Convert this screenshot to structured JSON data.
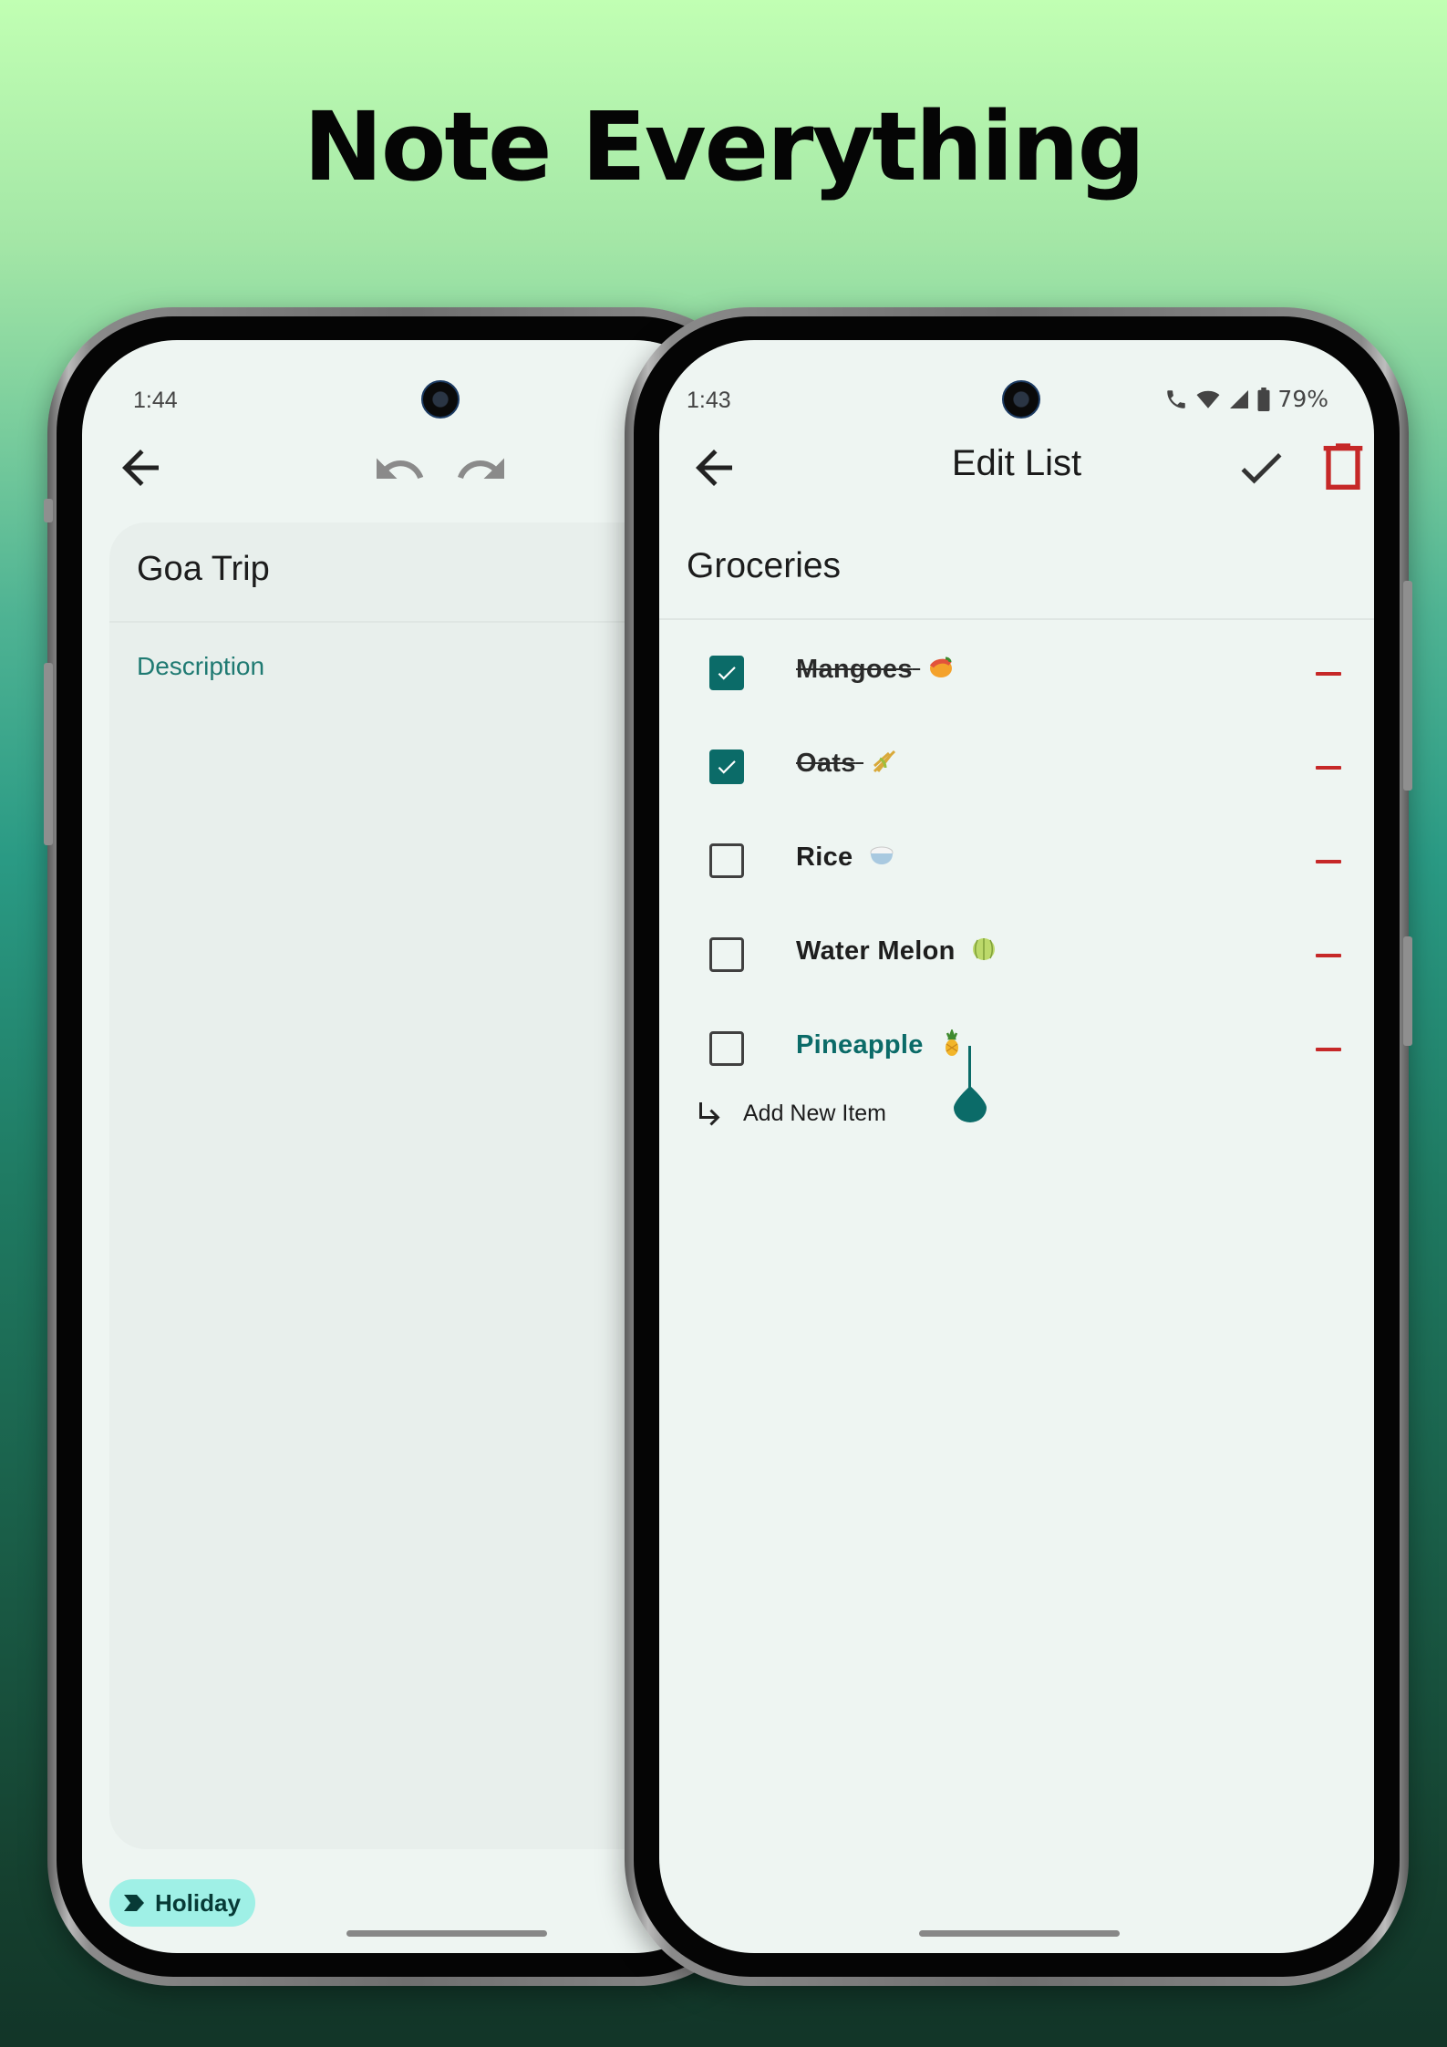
{
  "headline": "Note Everything",
  "left_phone": {
    "status_time": "1:44",
    "note_title": "Goa Trip",
    "description_placeholder": "Description",
    "label_chip": "Holiday",
    "icons": [
      "back-arrow-icon",
      "undo-icon",
      "redo-icon",
      "label-icon"
    ]
  },
  "right_phone": {
    "status_time": "1:43",
    "battery": "79%",
    "screen_title": "Edit List",
    "list_name": "Groceries",
    "items": [
      {
        "text": "Mangoes",
        "emoji": "mango",
        "checked": true
      },
      {
        "text": "Oats",
        "emoji": "sheaf",
        "checked": true
      },
      {
        "text": "Rice",
        "emoji": "rice-bowl",
        "checked": false
      },
      {
        "text": "Water Melon",
        "emoji": "melon",
        "checked": false
      },
      {
        "text": "Pineapple",
        "emoji": "pineapple",
        "checked": false,
        "editing": true
      }
    ],
    "add_item_label": "Add New Item",
    "icons": [
      "back-arrow-icon",
      "checkmark-icon",
      "trash-icon",
      "minus-icon",
      "subdirectory-arrow-icon"
    ],
    "colors": {
      "accent": "#0b6b68",
      "danger": "#c62828"
    }
  }
}
